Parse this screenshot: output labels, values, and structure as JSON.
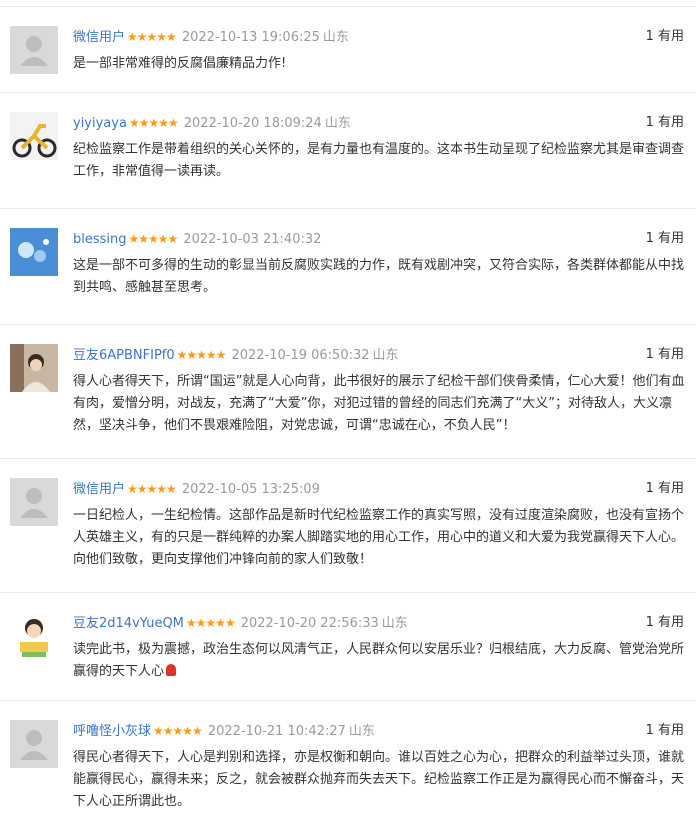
{
  "useful_suffix": "有用",
  "stars": "★★★★★",
  "reviews": [
    {
      "nick": "微信用户",
      "time": "2022-10-13 19:06:25",
      "loc": "山东",
      "useful": "1",
      "text": "是一部非常难得的反腐倡廉精品力作!",
      "avatar": "default"
    },
    {
      "nick": "yiyiyaya",
      "time": "2022-10-20 18:09:24",
      "loc": "山东",
      "useful": "1",
      "text": "纪检监察工作是带着组织的关心关怀的，是有力量也有温度的。这本书生动呈现了纪检监察尤其是审查调查工作，非常值得一读再读。",
      "avatar": "bike"
    },
    {
      "nick": "blessing",
      "time": "2022-10-03 21:40:32",
      "loc": "",
      "useful": "1",
      "text": "这是一部不可多得的生动的彰显当前反腐败实践的力作，既有戏剧冲突，又符合实际，各类群体都能从中找到共鸣、感触甚至思考。",
      "avatar": "blue"
    },
    {
      "nick": "豆友6APBNFIPf0",
      "time": "2022-10-19 06:50:32",
      "loc": "山东",
      "useful": "1",
      "text": "得人心者得天下，所谓“国运”就是人心向背，此书很好的展示了纪检干部们侠骨柔情，仁心大爱！他们有血有肉，爱憎分明，对战友，充满了“大爱”你，对犯过错的曾经的同志们充满了“大义”；对待敌人，大义凛然，坚决斗争，他们不畏艰难险阻，对党忠诚，可谓“忠诚在心，不负人民”！",
      "avatar": "photo"
    },
    {
      "nick": "微信用户",
      "time": "2022-10-05 13:25:09",
      "loc": "",
      "useful": "1",
      "text": "一日纪检人，一生纪检情。这部作品是新时代纪检监察工作的真实写照，没有过度渲染腐败，也没有宣扬个人英雄主义，有的只是一群纯粹的办案人脚踏实地的用心工作，用心中的道义和大爱为我党赢得天下人心。向他们致敬，更向支撑他们冲锋向前的家人们致敬！",
      "avatar": "default"
    },
    {
      "nick": "豆友2d14vYueQM",
      "time": "2022-10-20 22:56:33",
      "loc": "山东",
      "useful": "1",
      "text": "读完此书，极为震撼，政治生态何以风清气正，人民群众何以安居乐业？归根结底，大力反腐、管党治党所赢得的天下人心",
      "avatar": "cartoon"
    },
    {
      "nick": "呼噜怪小灰球",
      "time": "2022-10-21 10:42:27",
      "loc": "山东",
      "useful": "1",
      "text": "得民心者得天下，人心是判别和选择，亦是权衡和朝向。谁以百姓之心为心，把群众的利益举过头顶，谁就能赢得民心，赢得未来；反之，就会被群众抛弃而失去天下。纪检监察工作正是为赢得民心而不懈奋斗，天下人心正所谓此也。",
      "avatar": "default"
    }
  ]
}
